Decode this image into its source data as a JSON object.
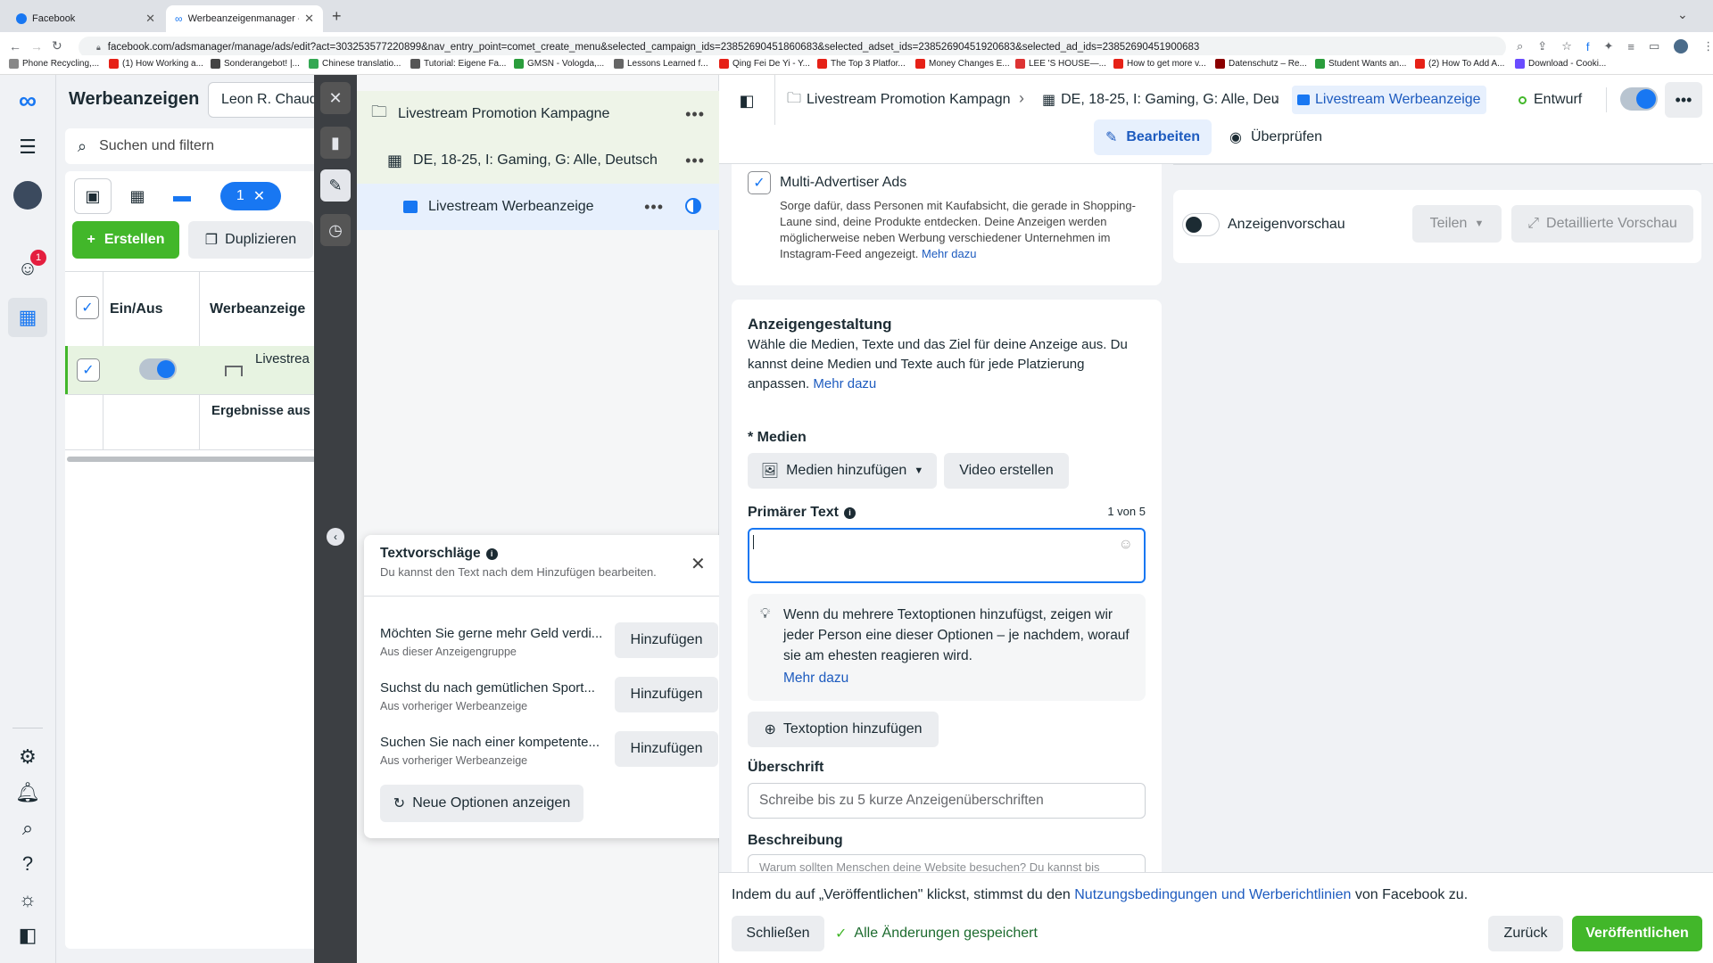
{
  "browser": {
    "tabs": [
      {
        "title": "Facebook"
      },
      {
        "title": "Werbeanzeigenmanager - Wer"
      }
    ],
    "url": "facebook.com/adsmanager/manage/ads/edit?act=303253577220899&nav_entry_point=comet_create_menu&selected_campaign_ids=23852690451860683&selected_adset_ids=23852690451920683&selected_ad_ids=23852690451900683",
    "bookmarks": [
      "Phone Recycling,...",
      "(1) How Working a...",
      "Sonderangebot! |...",
      "Chinese translatio...",
      "Tutorial: Eigene Fa...",
      "GMSN - Vologda,...",
      "Lessons Learned f...",
      "Qing Fei De Yi - Y...",
      "The Top 3 Platfor...",
      "Money Changes E...",
      "LEE 'S HOUSE—...",
      "How to get more v...",
      "Datenschutz – Re...",
      "Student Wants an...",
      "(2) How To Add A...",
      "Download - Cooki..."
    ]
  },
  "rail": {
    "notification_count": "1"
  },
  "adsmanager": {
    "title": "Werbeanzeigen",
    "account": "Leon R. Chaudh",
    "search_placeholder": "Suchen und filtern",
    "selected_count": "1",
    "create_label": "Erstellen",
    "duplicate_label": "Duplizieren",
    "col_onoff": "Ein/Aus",
    "col_ad": "Werbeanzeige",
    "row_ad_name": "Livestrea",
    "results_label": "Ergebnisse aus"
  },
  "tree": {
    "campaign": "Livestream Promotion Kampagne",
    "adset": "DE, 18-25, I: Gaming, G: Alle, Deutsch",
    "ad": "Livestream Werbeanzeige"
  },
  "suggestions": {
    "title": "Textvorschläge",
    "subtitle": "Du kannst den Text nach dem Hinzufügen bearbeiten.",
    "items": [
      {
        "text": "Möchten Sie gerne mehr Geld verdi...",
        "source": "Aus dieser Anzeigengruppe",
        "button": "Hinzufügen"
      },
      {
        "text": "Suchst du nach gemütlichen Sport...",
        "source": "Aus vorheriger Werbeanzeige",
        "button": "Hinzufügen"
      },
      {
        "text": "Suchen Sie nach einer kompetente...",
        "source": "Aus vorheriger Werbeanzeige",
        "button": "Hinzufügen"
      }
    ],
    "more_label": "Neue Optionen anzeigen"
  },
  "header": {
    "crumb_campaign": "Livestream Promotion Kampagn",
    "crumb_adset": "DE, 18-25, I: Gaming, G: Alle, Deu",
    "crumb_ad": "Livestream Werbeanzeige",
    "status": "Entwurf",
    "edit_label": "Bearbeiten",
    "review_label": "Überprüfen"
  },
  "multi_advertiser": {
    "title": "Multi-Advertiser Ads",
    "desc": "Sorge dafür, dass Personen mit Kaufabsicht, die gerade in Shopping-Laune sind, deine Produkte entdecken. Deine Anzeigen werden möglicherweise neben Werbung verschiedener Unternehmen im Instagram-Feed angezeigt.",
    "more": "Mehr dazu"
  },
  "creative": {
    "title": "Anzeigengestaltung",
    "desc": "Wähle die Medien, Texte und das Ziel für deine Anzeige aus. Du kannst deine Medien und Texte auch für jede Platzierung anpassen.",
    "more": "Mehr dazu",
    "media_label": "* Medien",
    "add_media": "Medien hinzufügen",
    "create_video": "Video erstellen",
    "primary_text_label": "Primärer Text",
    "primary_text_count": "1 von 5",
    "hint": "Wenn du mehrere Textoptionen hinzufügst, zeigen wir jeder Person eine dieser Optionen – je nachdem, worauf sie am ehesten reagieren wird.",
    "hint_more": "Mehr dazu",
    "add_text_option": "Textoption hinzufügen",
    "headline_label": "Überschrift",
    "headline_placeholder": "Schreibe bis zu 5 kurze Anzeigenüberschriften",
    "description_label": "Beschreibung",
    "description_placeholder": "Warum sollten Menschen deine Website besuchen? Du kannst bis"
  },
  "preview": {
    "label": "Anzeigenvorschau",
    "share": "Teilen",
    "detailed": "Detaillierte Vorschau"
  },
  "footer": {
    "terms_prefix": "Indem du auf „Veröffentlichen\" klickst, stimmst du den",
    "terms_link": "Nutzungsbedingungen und Werberichtlinien",
    "terms_suffix": "von Facebook zu.",
    "close": "Schließen",
    "saved": "Alle Änderungen gespeichert",
    "back": "Zurück",
    "publish": "Veröffentlichen"
  },
  "colors": {
    "accent": "#1877f2",
    "green": "#42b72a",
    "link": "#1d5bbf"
  }
}
